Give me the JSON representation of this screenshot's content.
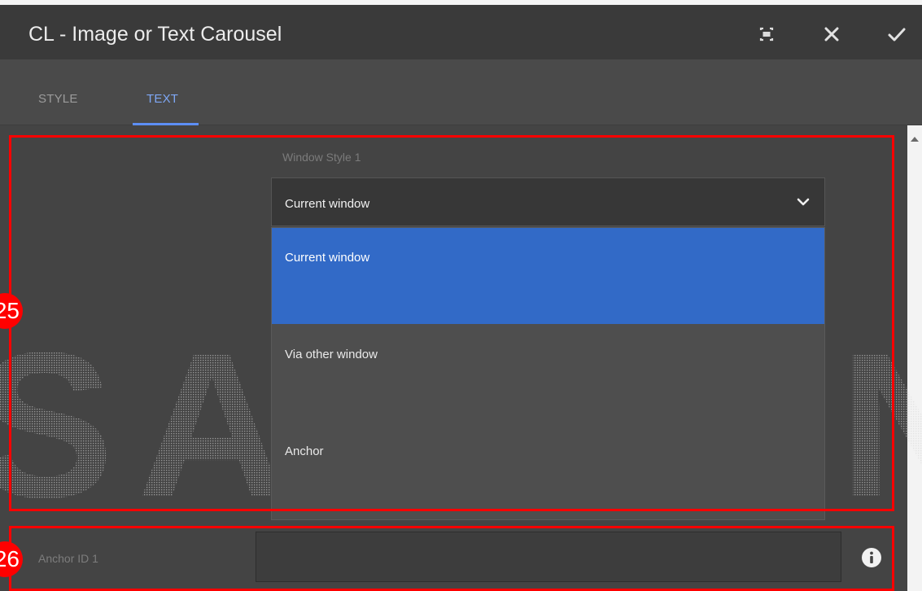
{
  "dialog": {
    "title": "CL - Image or Text Carousel",
    "toolbar_icons": [
      "fullscreen-icon",
      "close-icon",
      "check-icon"
    ]
  },
  "tabs": [
    {
      "label": "STYLE",
      "active": false
    },
    {
      "label": "TEXT",
      "active": true
    }
  ],
  "window_style": {
    "label": "Window Style 1",
    "selected": "Current window",
    "options": [
      "Current window",
      "Via other window",
      "Anchor"
    ]
  },
  "anchor": {
    "label": "Anchor ID 1",
    "value": "",
    "icon": "info-icon"
  },
  "annotations": [
    {
      "number": "25"
    },
    {
      "number": "26"
    }
  ],
  "watermark": {
    "text": "SAMSUNG"
  },
  "colors": {
    "accent": "#5d8ff5",
    "selected_option": "#326ac7",
    "annotation": "#ff0000",
    "background": "#444444"
  }
}
